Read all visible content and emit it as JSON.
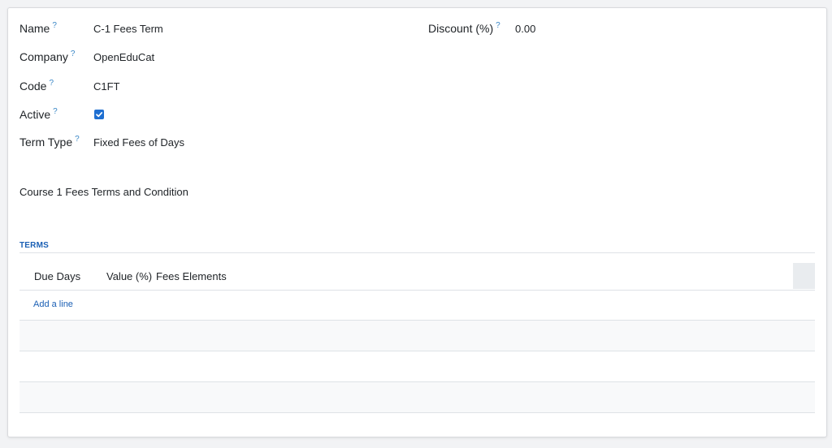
{
  "form": {
    "name": {
      "label": "Name",
      "help": "?",
      "value": "C-1 Fees Term"
    },
    "company": {
      "label": "Company",
      "help": "?",
      "value": "OpenEduCat"
    },
    "code": {
      "label": "Code",
      "help": "?",
      "value": "C1FT"
    },
    "active": {
      "label": "Active",
      "help": "?",
      "checked": true
    },
    "term_type": {
      "label": "Term Type",
      "help": "?",
      "value": "Fixed Fees of Days"
    },
    "discount": {
      "label": "Discount (%)",
      "help": "?",
      "value": "0.00"
    }
  },
  "description": "Course 1 Fees Terms and Condition",
  "terms": {
    "section_title": "TERMS",
    "columns": [
      "Due Days",
      "Value (%)",
      "Fees Elements"
    ],
    "add_line": "Add a line"
  },
  "colors": {
    "accent": "#1a5fb4",
    "help": "#3a87c6",
    "checkbox": "#1f6fd1"
  },
  "icons": {
    "help": "question-mark-icon",
    "checkbox": "checkmark-icon"
  }
}
